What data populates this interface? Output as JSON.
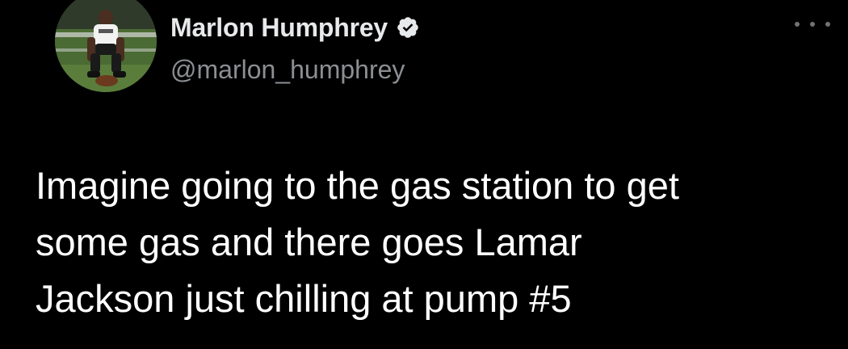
{
  "author": {
    "display_name": "Marlon Humphrey",
    "handle": "@marlon_humphrey",
    "verified": true,
    "avatar_icon": "profile-photo-football-player"
  },
  "menu": {
    "icon": "more-options-icon"
  },
  "tweet": {
    "lines": [
      "Imagine going to the gas station to get",
      "some gas and there goes Lamar",
      "Jackson just chilling at pump #5"
    ]
  },
  "colors": {
    "background": "#000000",
    "text": "#ffffff",
    "secondary_text": "#8b8f93",
    "verified_badge": "#e7e9ea"
  }
}
